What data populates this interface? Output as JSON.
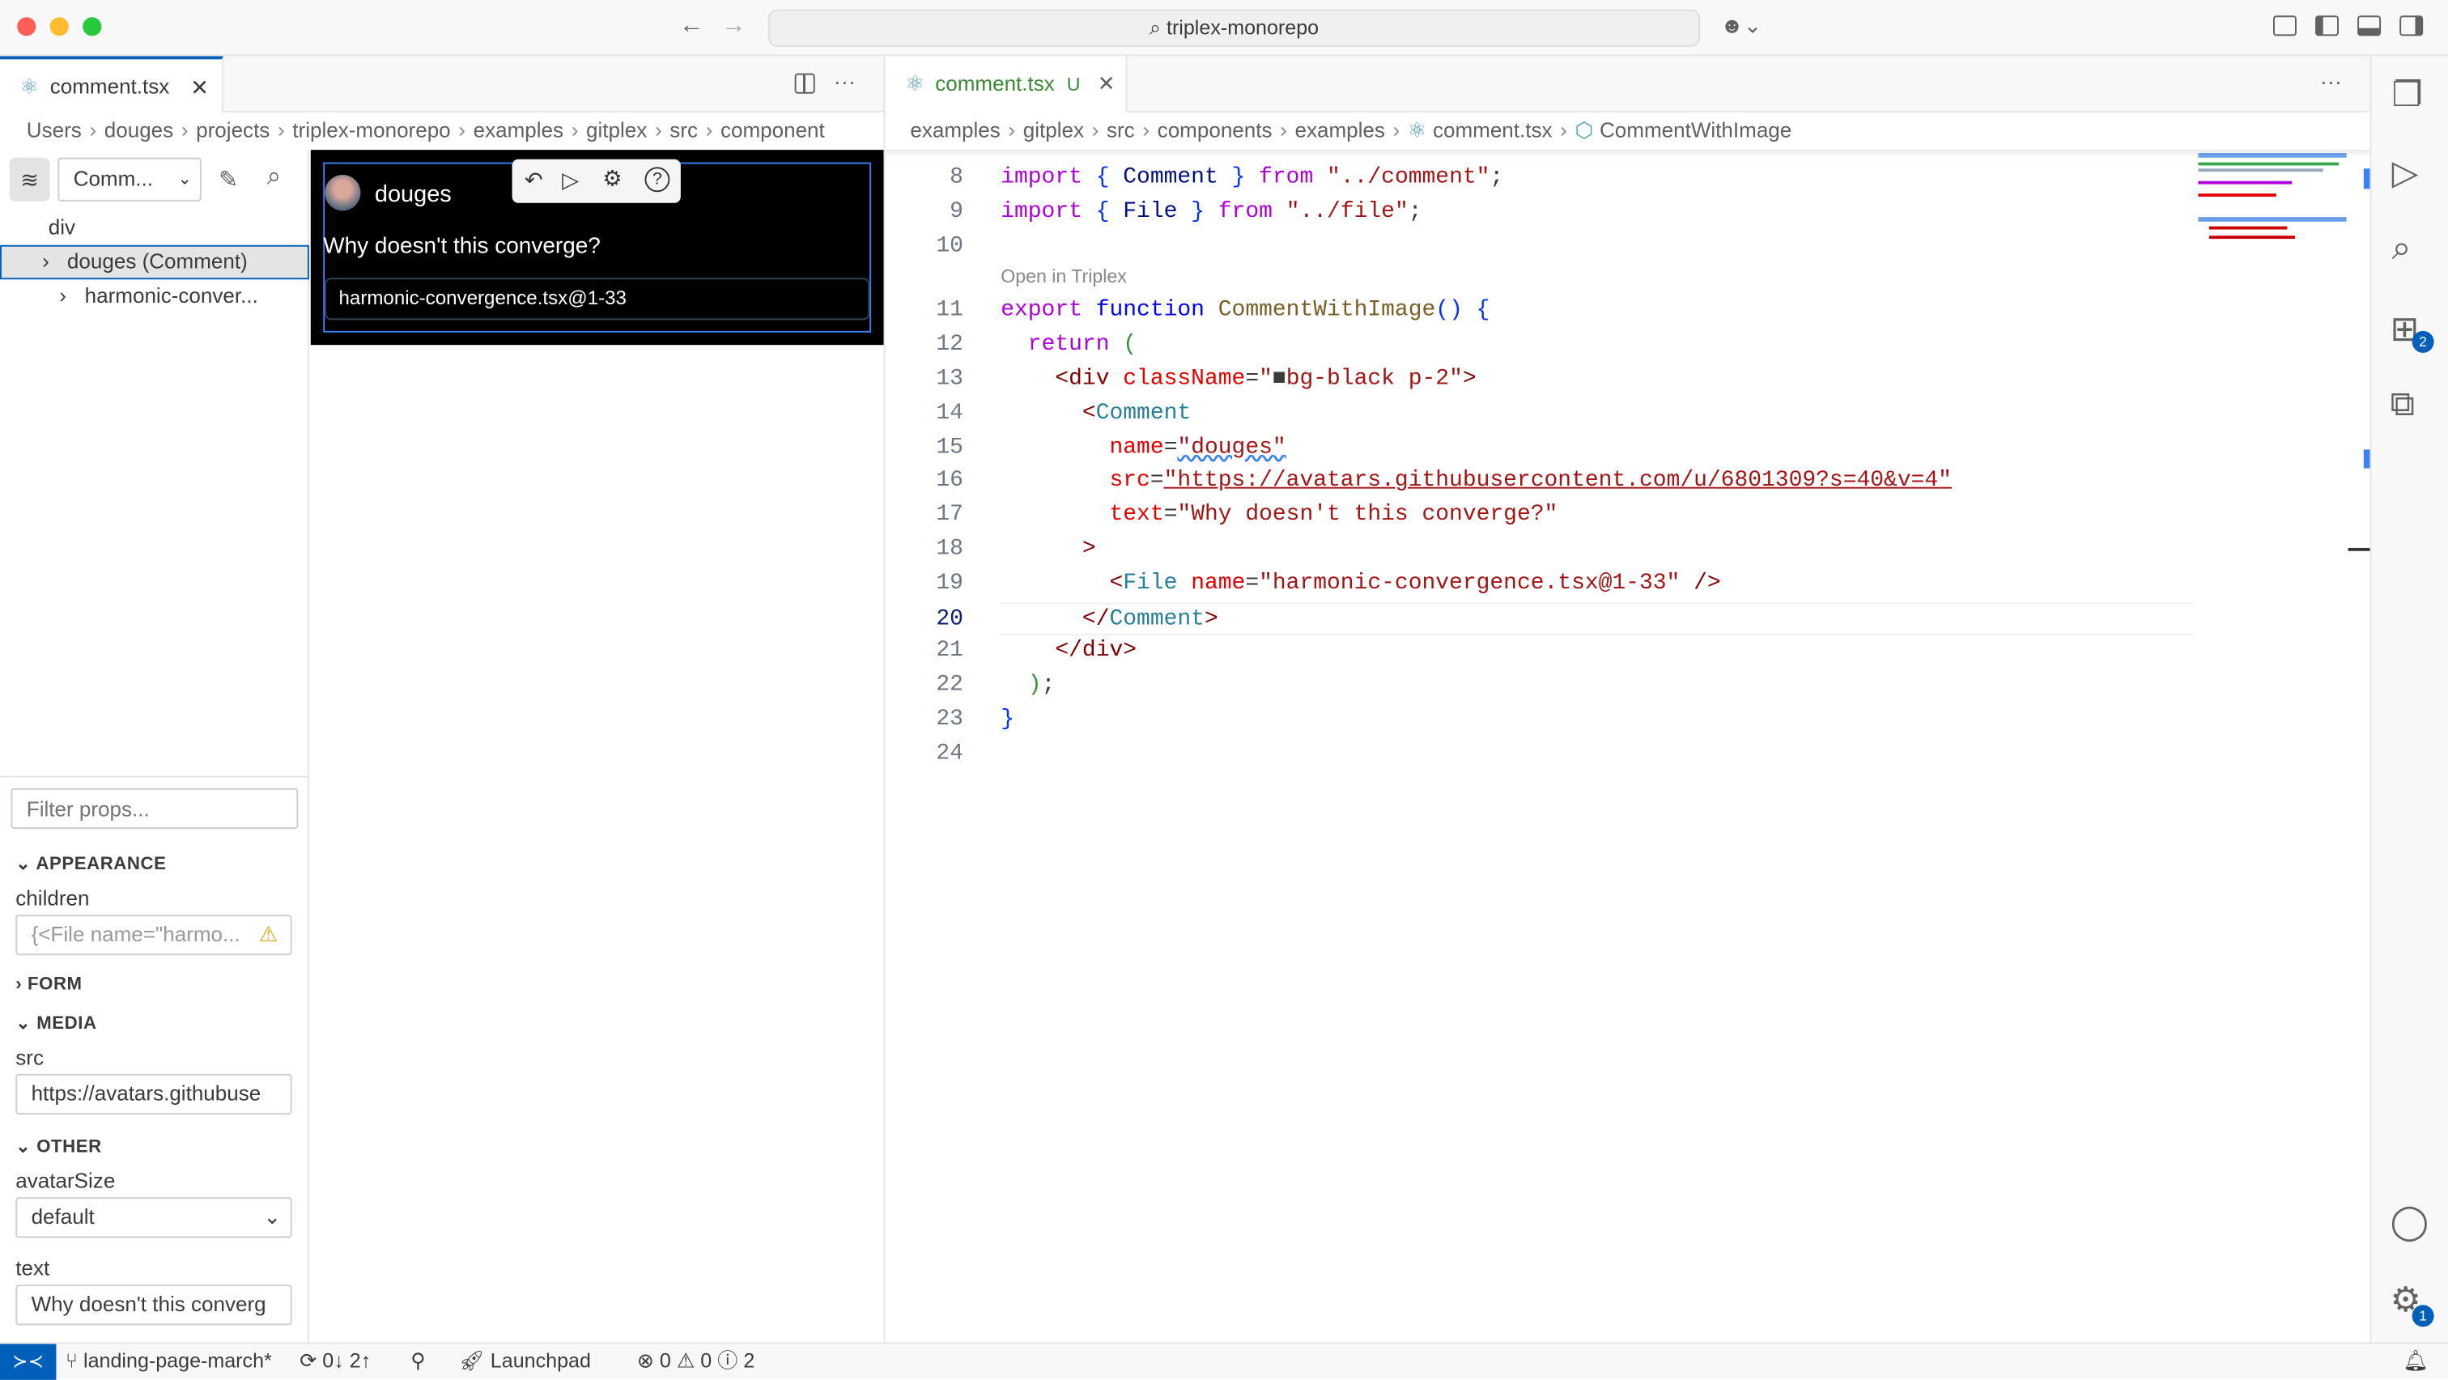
{
  "titlebar": {
    "search_text": "triplex-monorepo"
  },
  "left_group": {
    "tab": {
      "label": "comment.tsx"
    },
    "breadcrumb": [
      "Users",
      "douges",
      "projects",
      "triplex-monorepo",
      "examples",
      "gitplex",
      "src",
      "component"
    ],
    "triplex": {
      "component_select": "Comm...",
      "tree": [
        {
          "label": "div",
          "selected": false
        },
        {
          "label": "douges (Comment)",
          "selected": true
        },
        {
          "label": "harmonic-conver...",
          "selected": false
        }
      ],
      "filter_placeholder": "Filter props...",
      "sections": {
        "appearance": "APPEARANCE",
        "form": "FORM",
        "media": "MEDIA",
        "other": "OTHER"
      },
      "props": {
        "children_label": "children",
        "children_value": "{<File name=\"harmo...",
        "src_label": "src",
        "src_value": "https://avatars.githubuse",
        "avatarSize_label": "avatarSize",
        "avatarSize_value": "default",
        "text_label": "text",
        "text_value": "Why doesn't this converg"
      }
    },
    "preview": {
      "name": "douges",
      "text": "Why doesn't this converge?",
      "file": "harmonic-convergence.tsx@1-33"
    }
  },
  "right_group": {
    "tab": {
      "label": "comment.tsx",
      "status": "U"
    },
    "breadcrumb": [
      "examples",
      "gitplex",
      "src",
      "components",
      "examples",
      "comment.tsx",
      "CommentWithImage"
    ],
    "codelens": "Open in Triplex",
    "current_line": 20,
    "lines": [
      {
        "n": "8",
        "t": [
          [
            "import",
            "kw"
          ],
          [
            " ",
            ""
          ],
          [
            "{",
            "br"
          ],
          [
            " Comment ",
            "id"
          ],
          [
            "}",
            "br"
          ],
          [
            " ",
            ""
          ],
          [
            "from",
            "kw"
          ],
          [
            " ",
            ""
          ],
          [
            "\"../comment\"",
            "str"
          ],
          [
            ";",
            "pun"
          ]
        ]
      },
      {
        "n": "9",
        "t": [
          [
            "import",
            "kw"
          ],
          [
            " ",
            ""
          ],
          [
            "{",
            "br"
          ],
          [
            " File ",
            "id"
          ],
          [
            "}",
            "br"
          ],
          [
            " ",
            ""
          ],
          [
            "from",
            "kw"
          ],
          [
            " ",
            ""
          ],
          [
            "\"../file\"",
            "str"
          ],
          [
            ";",
            "pun"
          ]
        ]
      },
      {
        "n": "10",
        "t": []
      },
      {
        "n": "11",
        "t": [
          [
            "export",
            "kw"
          ],
          [
            " ",
            ""
          ],
          [
            "function",
            "fn"
          ],
          [
            " ",
            ""
          ],
          [
            "CommentWithImage",
            "fname"
          ],
          [
            "()",
            "br"
          ],
          [
            " ",
            ""
          ],
          [
            "{",
            "br"
          ]
        ]
      },
      {
        "n": "12",
        "t": [
          [
            "  ",
            ""
          ],
          [
            "return",
            "kw"
          ],
          [
            " ",
            ""
          ],
          [
            "(",
            "par"
          ]
        ]
      },
      {
        "n": "13",
        "t": [
          [
            "    ",
            ""
          ],
          [
            "<div",
            "tag"
          ],
          [
            " ",
            ""
          ],
          [
            "className",
            "attr"
          ],
          [
            "=",
            "pun"
          ],
          [
            "\"",
            "str"
          ],
          [
            "■",
            "pun"
          ],
          [
            "bg-black p-2\"",
            "str"
          ],
          [
            ">",
            "tag"
          ]
        ]
      },
      {
        "n": "14",
        "t": [
          [
            "      ",
            ""
          ],
          [
            "<",
            "tag"
          ],
          [
            "Comment",
            "comp"
          ]
        ]
      },
      {
        "n": "15",
        "t": [
          [
            "        ",
            ""
          ],
          [
            "name",
            "attr"
          ],
          [
            "=",
            "pun"
          ],
          [
            "\"douges\"",
            "str"
          ]
        ]
      },
      {
        "n": "16",
        "t": [
          [
            "        ",
            ""
          ],
          [
            "src",
            "attr"
          ],
          [
            "=",
            "pun"
          ],
          [
            "\"https://avatars.githubusercontent.com/u/6801309?s=40&v=4\"",
            "str"
          ]
        ]
      },
      {
        "n": "17",
        "t": [
          [
            "        ",
            ""
          ],
          [
            "text",
            "attr"
          ],
          [
            "=",
            "pun"
          ],
          [
            "\"Why doesn't this converge?\"",
            "str"
          ]
        ]
      },
      {
        "n": "18",
        "t": [
          [
            "      ",
            ""
          ],
          [
            ">",
            "tag"
          ]
        ]
      },
      {
        "n": "19",
        "t": [
          [
            "        ",
            ""
          ],
          [
            "<",
            "tag"
          ],
          [
            "File",
            "comp"
          ],
          [
            " ",
            ""
          ],
          [
            "name",
            "attr"
          ],
          [
            "=",
            "pun"
          ],
          [
            "\"harmonic-convergence.tsx@1-33\"",
            "str"
          ],
          [
            " />",
            "tag"
          ]
        ]
      },
      {
        "n": "20",
        "t": [
          [
            "      ",
            ""
          ],
          [
            "</",
            "tag"
          ],
          [
            "Comment",
            "comp"
          ],
          [
            ">",
            "tag"
          ]
        ]
      },
      {
        "n": "21",
        "t": [
          [
            "    ",
            ""
          ],
          [
            "</div>",
            "tag"
          ]
        ]
      },
      {
        "n": "22",
        "t": [
          [
            "  ",
            ""
          ],
          [
            ")",
            "par"
          ],
          [
            ";",
            "pun"
          ]
        ]
      },
      {
        "n": "23",
        "t": [
          [
            "}",
            "br"
          ]
        ]
      },
      {
        "n": "24",
        "t": []
      }
    ]
  },
  "activity_badges": {
    "extensions": "2",
    "settings": "1"
  },
  "statusbar": {
    "branch": "landing-page-march*",
    "sync": "0↓ 2↑",
    "launchpad": "Launchpad",
    "errors": "0",
    "warnings": "0",
    "info": "2"
  },
  "colors": {
    "accent": "#005fb8",
    "preview_bg": "#000000",
    "selection_border": "#3b82f6",
    "untracked": "#388a34"
  }
}
